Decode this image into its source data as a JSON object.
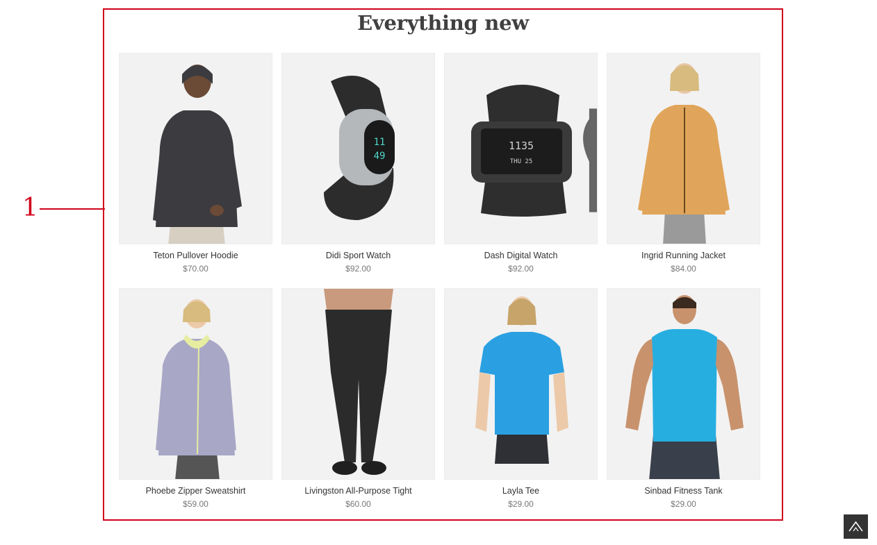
{
  "annotation": {
    "label": "1"
  },
  "section": {
    "title": "Everything new"
  },
  "products": [
    {
      "name": "Teton Pullover Hoodie",
      "price": "$70.00",
      "image": "man-dark-hoodie"
    },
    {
      "name": "Didi Sport Watch",
      "price": "$92.00",
      "image": "sport-watch"
    },
    {
      "name": "Dash Digital Watch",
      "price": "$92.00",
      "image": "digital-watch"
    },
    {
      "name": "Ingrid Running Jacket",
      "price": "$84.00",
      "image": "woman-orange-jacket"
    },
    {
      "name": "Phoebe Zipper Sweatshirt",
      "price": "$59.00",
      "image": "woman-lavender-sweatshirt"
    },
    {
      "name": "Livingston All-Purpose Tight",
      "price": "$60.00",
      "image": "man-black-tights"
    },
    {
      "name": "Layla Tee",
      "price": "$29.00",
      "image": "woman-blue-tee"
    },
    {
      "name": "Sinbad Fitness Tank",
      "price": "$29.00",
      "image": "man-blue-tank"
    }
  ],
  "hover_actions": {
    "wishlist_icon": "heart-icon",
    "compare_icon": "compare-icon"
  },
  "back_to_top": {
    "icon": "chevron-up-icon"
  },
  "colors": {
    "frame": "#d0021b",
    "title": "#404040",
    "price": "#777777",
    "back_to_top_bg": "#333333"
  }
}
